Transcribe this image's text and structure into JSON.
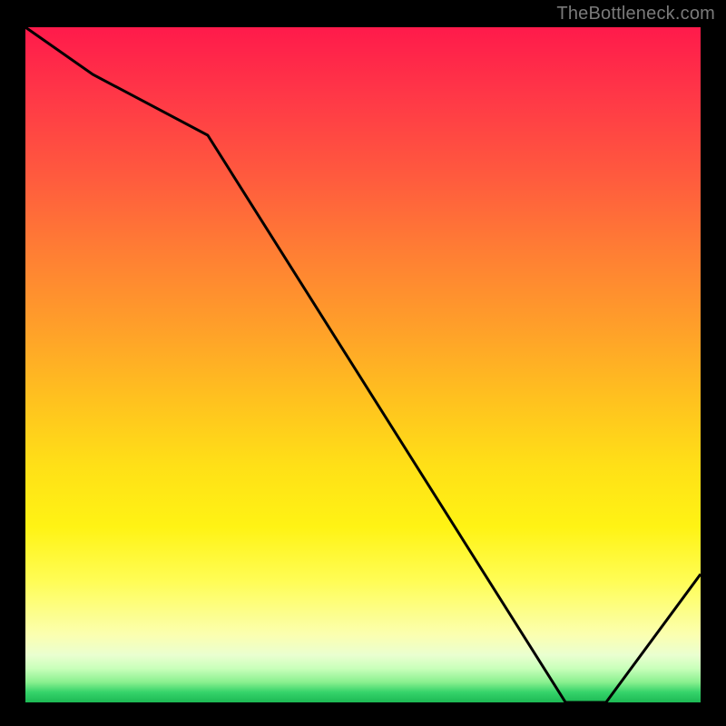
{
  "attribution": "TheBottleneck.com",
  "chart_data": {
    "type": "line",
    "title": "",
    "xlabel": "",
    "ylabel": "",
    "xlim": [
      0,
      100
    ],
    "ylim": [
      0,
      100
    ],
    "series": [
      {
        "name": "curve",
        "x": [
          0,
          10,
          27,
          80,
          86,
          100
        ],
        "values": [
          100,
          93,
          84,
          0,
          0,
          19
        ]
      }
    ],
    "grid": false,
    "legend": false,
    "background": "vertical-gradient",
    "gradient_stops": [
      {
        "pos": 0.0,
        "color": "#ff1a4b"
      },
      {
        "pos": 0.5,
        "color": "#ffc11f"
      },
      {
        "pos": 0.8,
        "color": "#fff314"
      },
      {
        "pos": 0.95,
        "color": "#c8ffba"
      },
      {
        "pos": 1.0,
        "color": "#1db954"
      }
    ]
  }
}
